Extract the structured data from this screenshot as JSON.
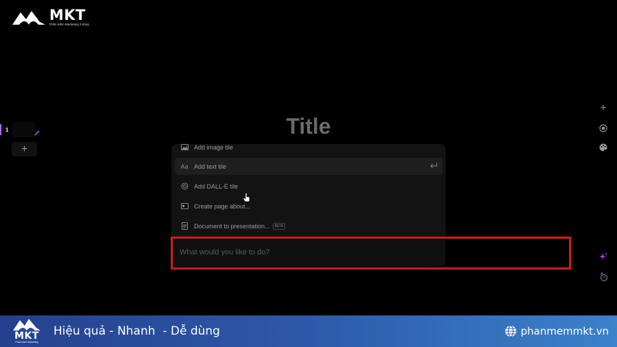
{
  "logo": {
    "name": "MKT",
    "tagline": "Phần mềm Marketing 3 dùng"
  },
  "slides": {
    "items": [
      {
        "number": "1"
      }
    ],
    "add_symbol": "+"
  },
  "slide": {
    "title": "Title"
  },
  "command_menu": {
    "items": [
      {
        "label": "Add image tile",
        "icon": "image-icon"
      },
      {
        "label": "Add text tile",
        "icon": "text-format-icon",
        "icon_text": "Aa",
        "highlighted": true
      },
      {
        "label": "Add DALL-E tile",
        "icon": "openai-icon"
      },
      {
        "label": "Create page about...",
        "icon": "page-icon"
      },
      {
        "label": "Document to presentation...",
        "icon": "document-icon",
        "badge": "BETA"
      }
    ],
    "input_placeholder": "What would you like to do?"
  },
  "right_toolbar": [
    {
      "name": "add-icon",
      "symbol": "+"
    },
    {
      "name": "target-icon"
    },
    {
      "name": "palette-icon"
    },
    {
      "name": "sparkle-icon",
      "color": "#c13cff"
    },
    {
      "name": "help-icon",
      "symbol": "?"
    }
  ],
  "banner": {
    "logo_name": "MKT",
    "logo_tagline": "Phần mềm Marketing",
    "slogan": "Hiệu quả - Nhanh  - Dễ dùng",
    "website": "phanmemmkt.vn"
  },
  "colors": {
    "accent": "#b06cf0",
    "highlight_frame": "#d61a1a",
    "banner_start": "#24408e",
    "banner_end": "#3b82c9"
  }
}
